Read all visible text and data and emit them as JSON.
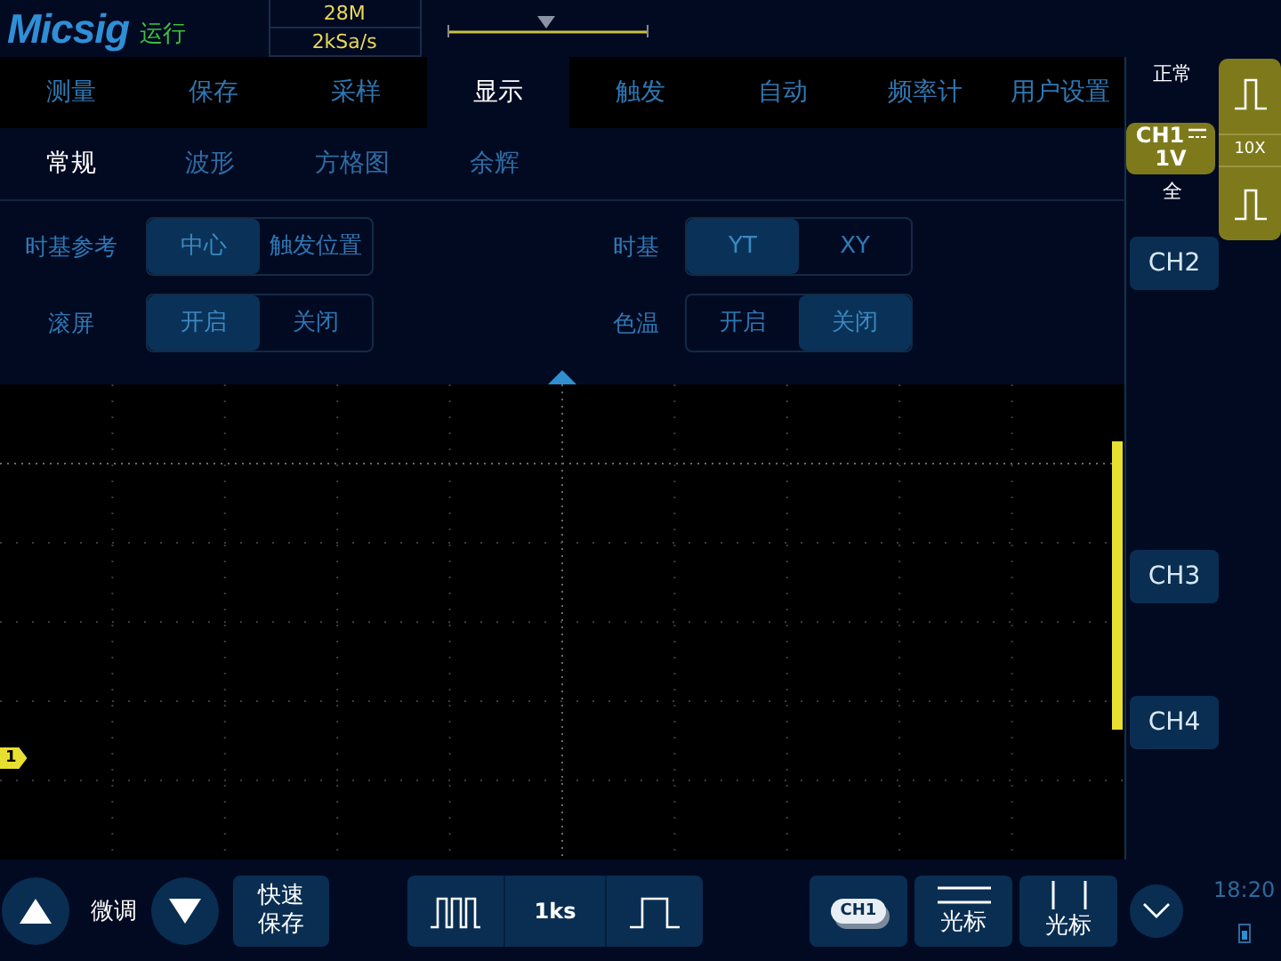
{
  "header": {
    "logo": "Micsig",
    "run_state": "运行",
    "memory_depth": "28M",
    "sample_rate": "2kSa/s"
  },
  "menu_tabs": [
    {
      "label": "测量",
      "selected": false
    },
    {
      "label": "保存",
      "selected": false
    },
    {
      "label": "采样",
      "selected": false
    },
    {
      "label": "显示",
      "selected": true
    },
    {
      "label": "触发",
      "selected": false
    },
    {
      "label": "自动",
      "selected": false
    },
    {
      "label": "频率计",
      "selected": false
    },
    {
      "label": "用户设置",
      "selected": false
    }
  ],
  "sub_tabs": [
    {
      "label": "常规",
      "selected": true
    },
    {
      "label": "波形",
      "selected": false
    },
    {
      "label": "方格图",
      "selected": false
    },
    {
      "label": "余辉",
      "selected": false
    }
  ],
  "settings": [
    {
      "label": "时基参考",
      "options": [
        {
          "label": "中心",
          "selected": true
        },
        {
          "label": "触发位置",
          "selected": false
        }
      ]
    },
    {
      "label": "时基",
      "options": [
        {
          "label": "YT",
          "selected": true
        },
        {
          "label": "XY",
          "selected": false
        }
      ]
    },
    {
      "label": "滚屏",
      "options": [
        {
          "label": "开启",
          "selected": true
        },
        {
          "label": "关闭",
          "selected": false
        }
      ]
    },
    {
      "label": "色温",
      "options": [
        {
          "label": "开启",
          "selected": false
        },
        {
          "label": "关闭",
          "selected": true
        }
      ]
    }
  ],
  "waveform": {
    "channel_marker": "1"
  },
  "right_panel": {
    "trigger_mode": "正常",
    "ch1": {
      "label": "CH1",
      "scale": "1V",
      "coupling": "全"
    },
    "probe": "10X",
    "channels": [
      {
        "label": "CH2"
      },
      {
        "label": "CH3"
      },
      {
        "label": "CH4"
      }
    ]
  },
  "bottom_bar": {
    "fine_label": "微调",
    "quick_save": "快速保存",
    "timebase": "1ks",
    "channel_button": "CH1",
    "cursor_buttons": [
      "光标",
      "光标"
    ],
    "clock": "18:20"
  }
}
